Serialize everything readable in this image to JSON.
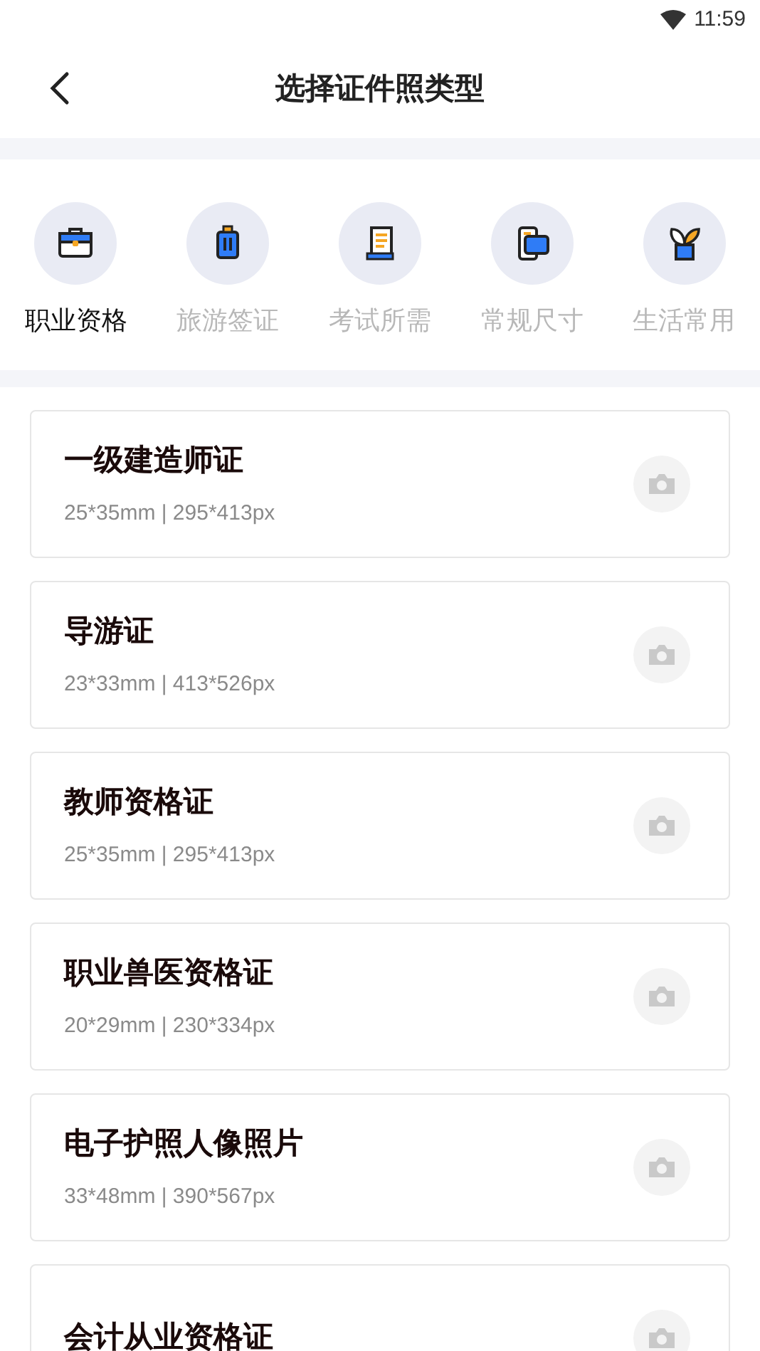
{
  "status_bar": {
    "time": "11:59"
  },
  "header": {
    "title": "选择证件照类型"
  },
  "categories": [
    {
      "label": "职业资格",
      "selected": true
    },
    {
      "label": "旅游签证",
      "selected": false
    },
    {
      "label": "考试所需",
      "selected": false
    },
    {
      "label": "常规尺寸",
      "selected": false
    },
    {
      "label": "生活常用",
      "selected": false
    }
  ],
  "items": [
    {
      "title": "一级建造师证",
      "size": "25*35mm | 295*413px"
    },
    {
      "title": "导游证",
      "size": "23*33mm | 413*526px"
    },
    {
      "title": "教师资格证",
      "size": "25*35mm | 295*413px"
    },
    {
      "title": "职业兽医资格证",
      "size": "20*29mm | 230*334px"
    },
    {
      "title": "电子护照人像照片",
      "size": "33*48mm | 390*567px"
    },
    {
      "title": "会计从业资格证"
    }
  ]
}
